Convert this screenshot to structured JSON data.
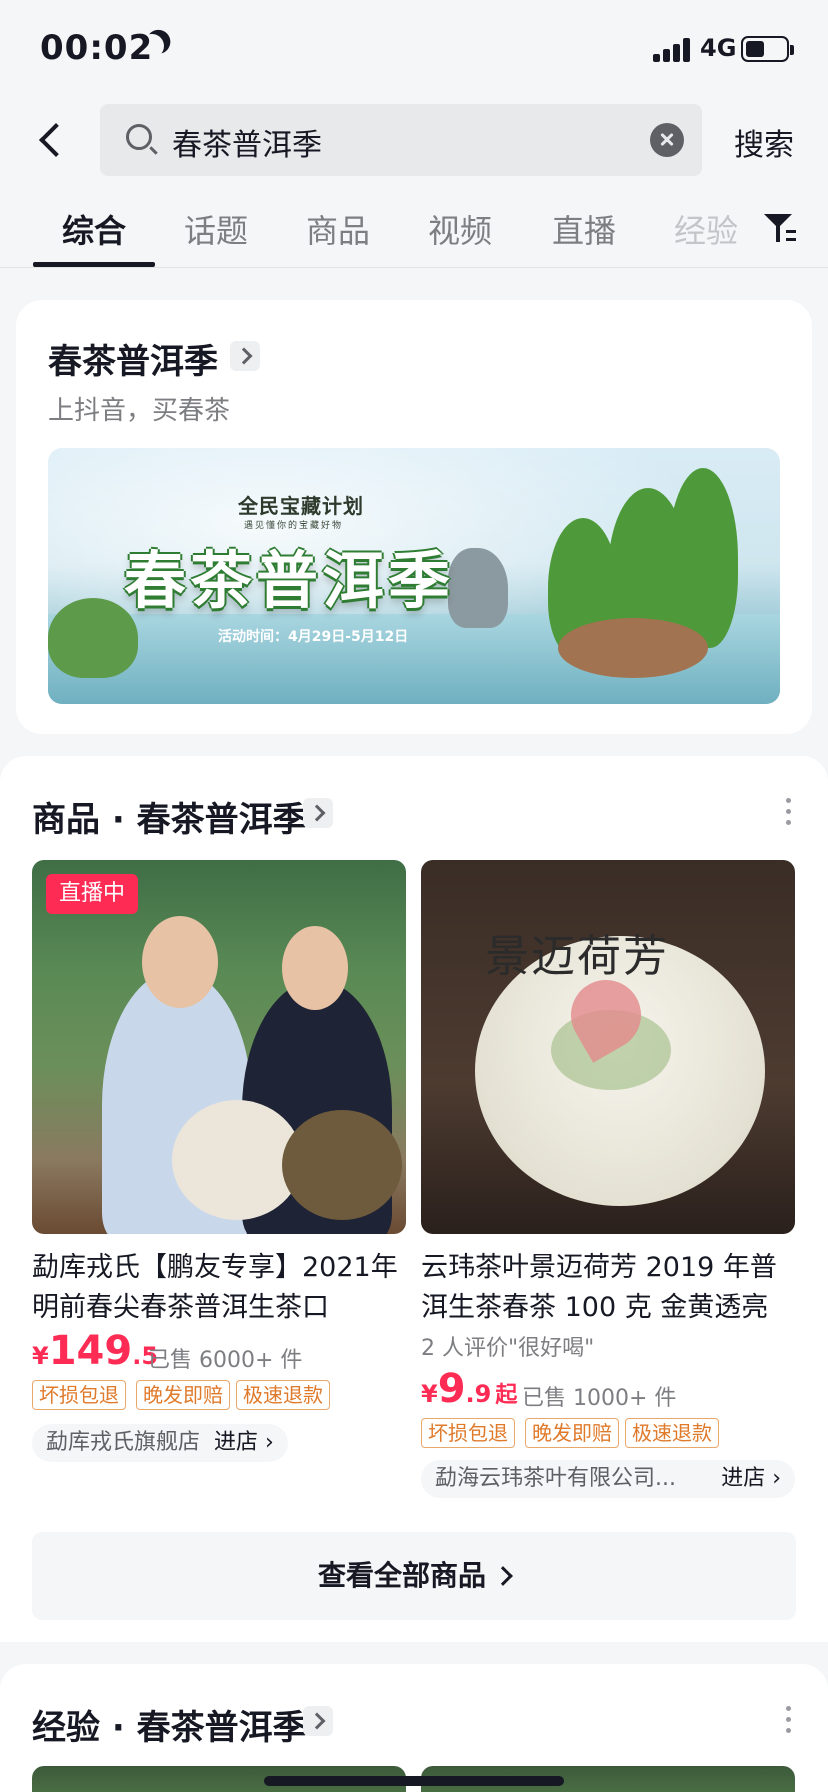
{
  "status_bar": {
    "time": "00:02",
    "network": "4G"
  },
  "search": {
    "query": "春茶普洱季",
    "button_label": "搜索"
  },
  "tabs": [
    {
      "label": "综合",
      "active": true
    },
    {
      "label": "话题"
    },
    {
      "label": "商品"
    },
    {
      "label": "视频"
    },
    {
      "label": "直播"
    },
    {
      "label": "经验"
    }
  ],
  "topic_card": {
    "title": "春茶普洱季",
    "subtitle": "上抖音，买春茶",
    "banner": {
      "plan": "全民宝藏计划",
      "plan_sub": "遇见懂你的宝藏好物",
      "headline": "春茶普洱季",
      "dates": "活动时间：4月29日-5月12日"
    }
  },
  "products_section": {
    "title": "商品 · 春茶普洱季",
    "items": [
      {
        "badge": "直播中",
        "title": "勐库戎氏【鹏友专享】2021年明前春尖春茶普洱生茶口",
        "price_currency": "¥",
        "price_int": "149",
        "price_dec": ".5",
        "sold": "已售 6000+ 件",
        "tags": [
          "坏损包退",
          "晚发即赔",
          "极速退款"
        ],
        "shop": "勐库戎氏旗舰店",
        "enter": "进店 ›"
      },
      {
        "title": "云玮茶叶景迈荷芳 2019 年普洱生茶春茶 100 克 金黄透亮",
        "review": "2 人评价\"很好喝\"",
        "price_currency": "¥",
        "price_int": "9",
        "price_dec": ".9",
        "price_suffix": "起",
        "sold": "已售 1000+ 件",
        "tags": [
          "坏损包退",
          "晚发即赔",
          "极速退款"
        ],
        "shop": "勐海云玮茶叶有限公司...",
        "enter": "进店 ›",
        "cake_text": "景迈荷芳"
      }
    ],
    "view_all": "查看全部商品"
  },
  "experience_section": {
    "title": "经验 · 春茶普洱季"
  },
  "colors": {
    "accent": "#fe2c55",
    "tag": "#e07a2b",
    "text": "#161823",
    "muted": "#7d7e82"
  }
}
